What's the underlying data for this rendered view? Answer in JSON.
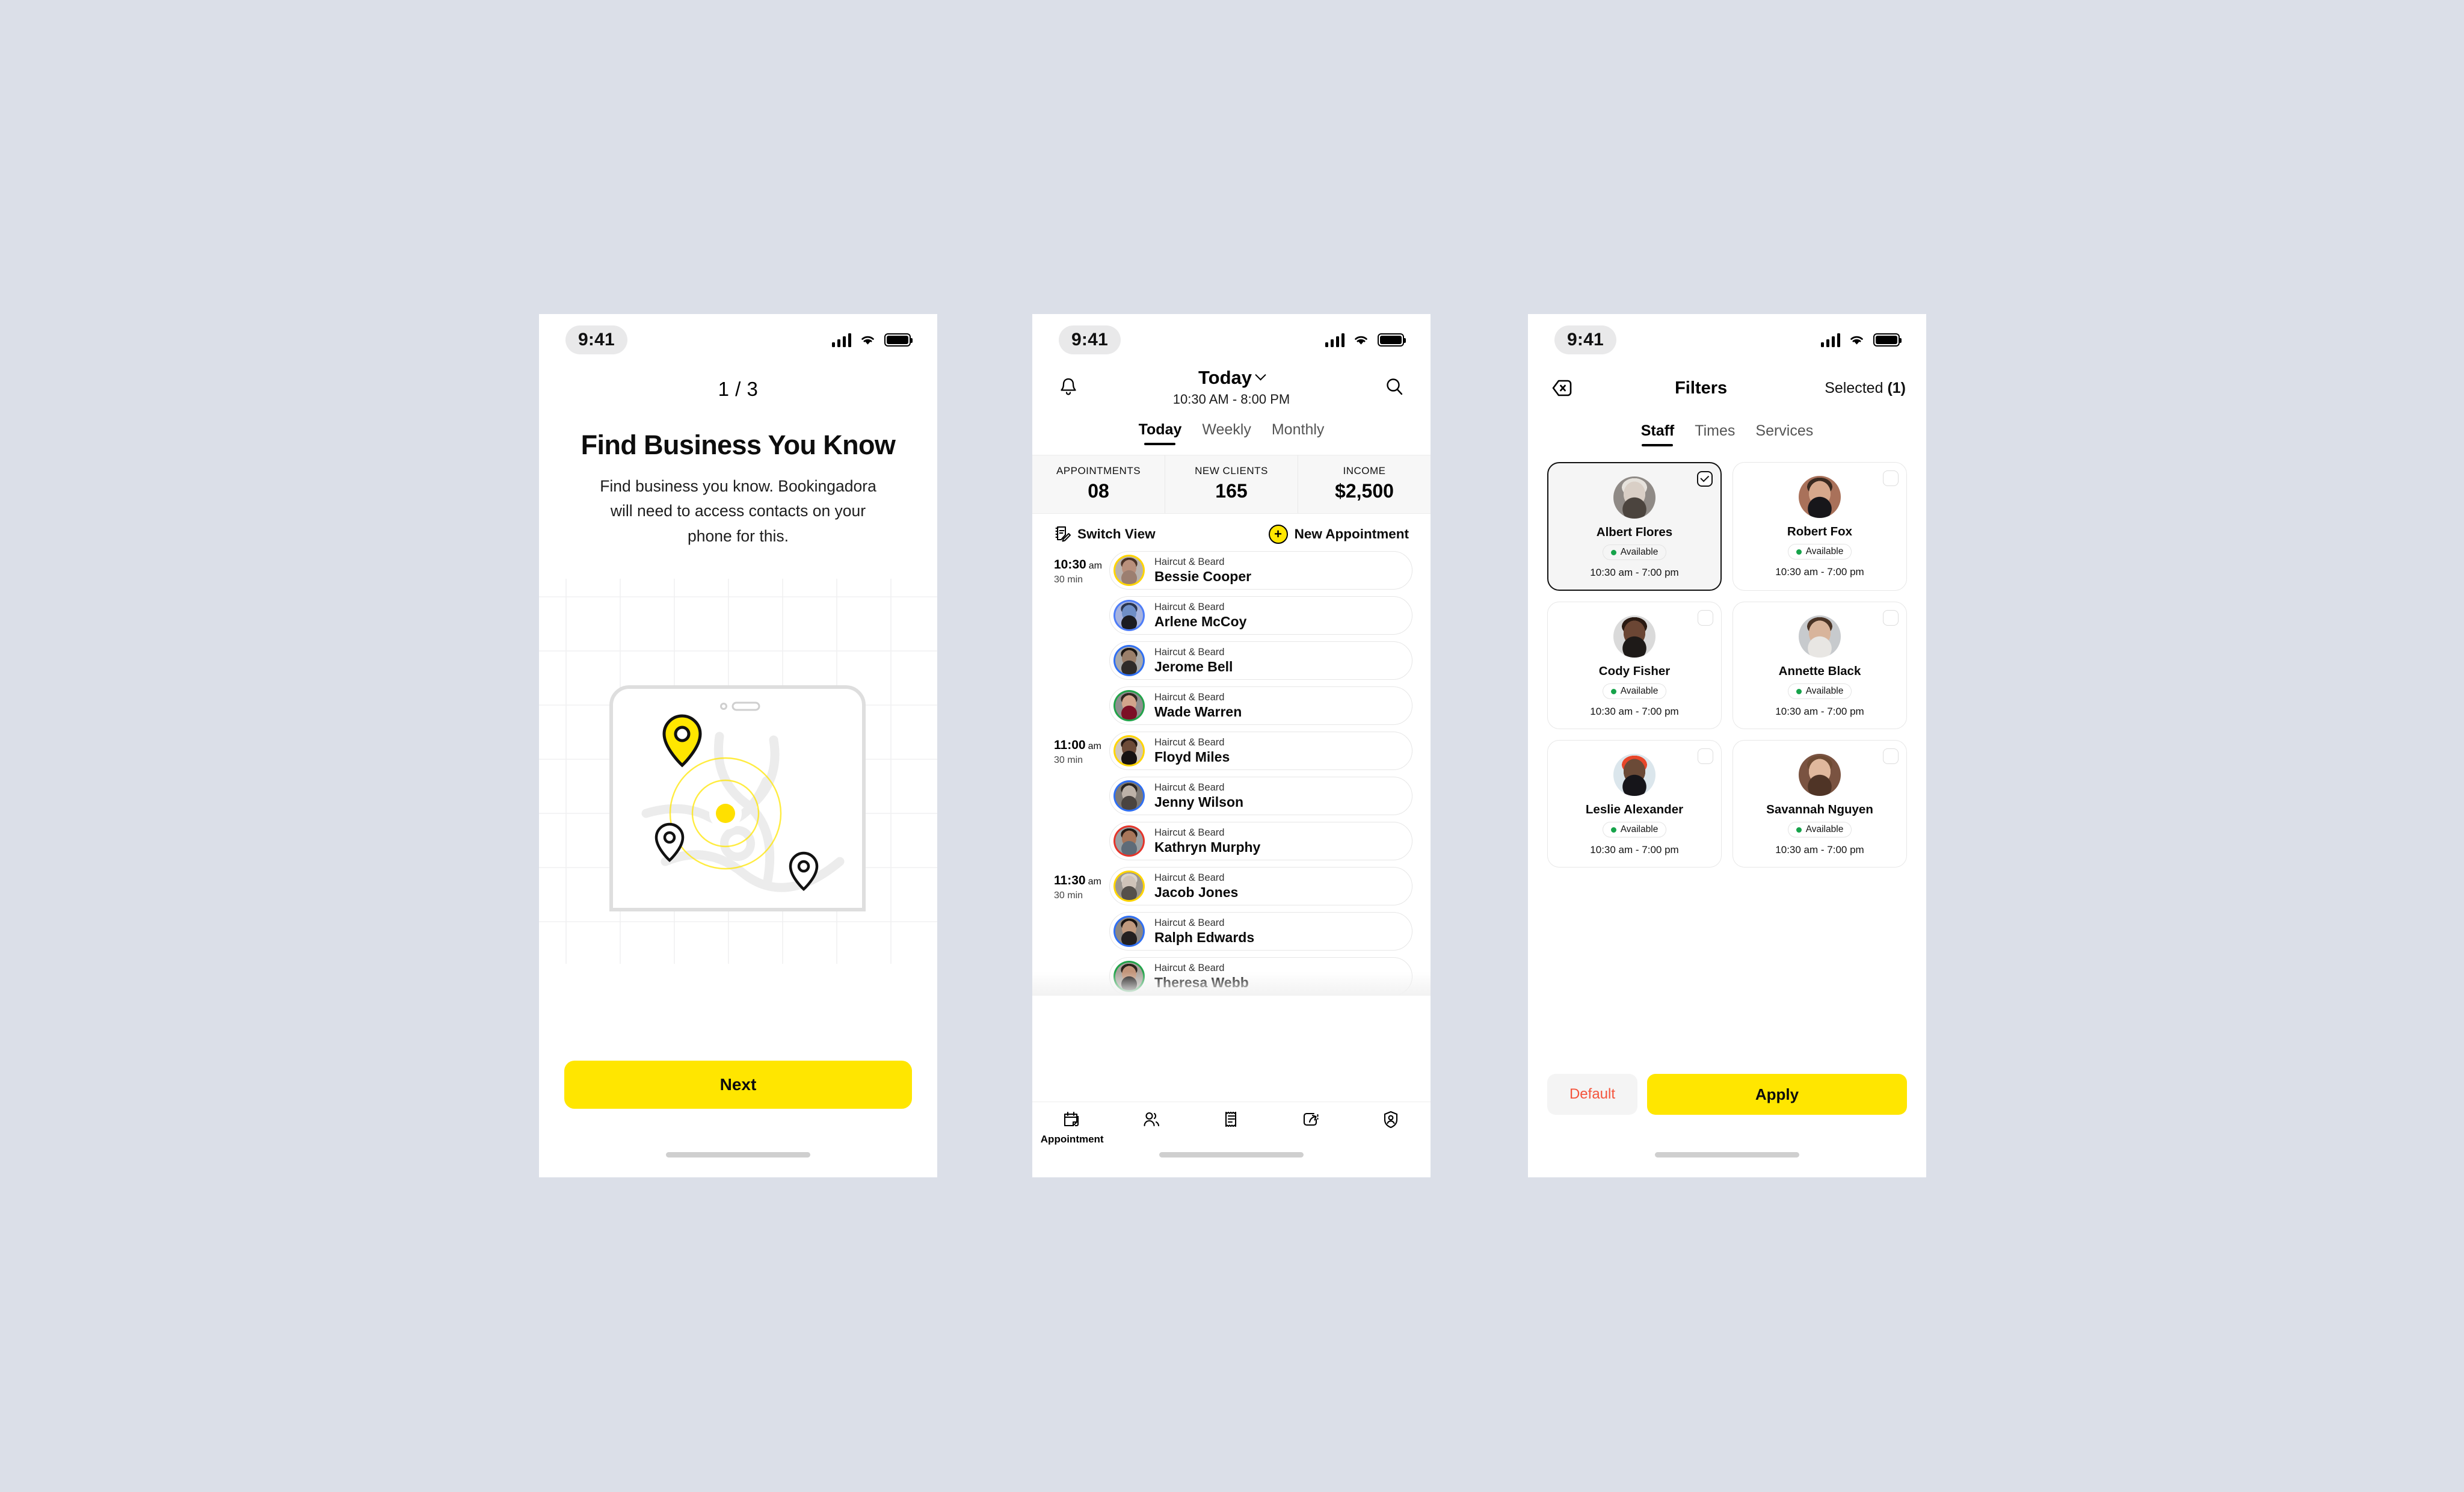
{
  "canvas": {
    "background": "#dbdfe8"
  },
  "theme": {
    "accent_yellow": "#ffe600",
    "text": "#0d0d0d",
    "green": "#16a34a",
    "red": "#f4543c"
  },
  "status_bar": {
    "time": "9:41",
    "signal_icon": "cellular-bars-icon",
    "wifi_icon": "wifi-icon",
    "battery_icon": "battery-icon"
  },
  "onboarding": {
    "pager": "1 / 3",
    "title": "Find Business You Know",
    "description": "Find business you know. Bookingadora will need to access contacts on your phone for this.",
    "next_label": "Next",
    "illustration": {
      "name": "map-location-illustration",
      "pin_active_icon": "map-pin-filled-icon",
      "pin_1_icon": "map-pin-outline-icon",
      "pin_2_icon": "map-pin-outline-icon",
      "pulse_icon": "location-pulse-icon"
    }
  },
  "appointments": {
    "bell_icon": "bell-icon",
    "search_icon": "search-icon",
    "title": "Today",
    "chevron_icon": "chevron-down-icon",
    "subtitle": "10:30 AM - 8:00 PM",
    "tabs": [
      {
        "label": "Today",
        "active": true
      },
      {
        "label": "Weekly",
        "active": false
      },
      {
        "label": "Monthly",
        "active": false
      }
    ],
    "stats": [
      {
        "label": "APPOINTMENTS",
        "value": "08"
      },
      {
        "label": "NEW CLIENTS",
        "value": "165"
      },
      {
        "label": "INCOME",
        "value": "$2,500"
      }
    ],
    "switch_view_label": "Switch View",
    "switch_view_icon": "switch-view-icon",
    "new_appointment_label": "New Appointment",
    "new_appointment_icon": "plus-circle-icon",
    "items": [
      {
        "time": "10:30",
        "ampm": "am",
        "duration": "30 min",
        "service": "Haircut & Beard",
        "name": "Bessie Cooper",
        "ring": "#ffd500",
        "skin": "#b9907c",
        "hair": "#4a3328",
        "shirt": "#9c7f70",
        "bg": "#b9b2ad"
      },
      {
        "time": "",
        "ampm": "",
        "duration": "",
        "service": "Haircut & Beard",
        "name": "Arlene McCoy",
        "ring": "#4d7cf7",
        "skin": "#6f8ec7",
        "hair": "#2a3550",
        "shirt": "#1b1b22",
        "bg": "#a7b3de"
      },
      {
        "time": "",
        "ampm": "",
        "duration": "",
        "service": "Haircut & Beard",
        "name": "Jerome Bell",
        "ring": "#2f6ff2",
        "skin": "#9b7f6a",
        "hair": "#1d1713",
        "shirt": "#2f2b29",
        "bg": "#a9a9a9"
      },
      {
        "time": "",
        "ampm": "",
        "duration": "",
        "service": "Haircut & Beard",
        "name": "Wade Warren",
        "ring": "#22a34a",
        "skin": "#d2a58c",
        "hair": "#2f2520",
        "shirt": "#7c1026",
        "bg": "#8e8e8e"
      },
      {
        "time": "11:00",
        "ampm": "am",
        "duration": "30 min",
        "service": "Haircut & Beard",
        "name": "Floyd Miles",
        "ring": "#ffd500",
        "skin": "#6d4b38",
        "hair": "#221712",
        "shirt": "#171312",
        "bg": "#cfc6bd"
      },
      {
        "time": "",
        "ampm": "",
        "duration": "",
        "service": "Haircut & Beard",
        "name": "Jenny Wilson",
        "ring": "#2f6ff2",
        "skin": "#bdb2a8",
        "hair": "#2a241f",
        "shirt": "#4a4440",
        "bg": "#7d7873"
      },
      {
        "time": "",
        "ampm": "",
        "duration": "",
        "service": "Haircut & Beard",
        "name": "Kathryn Murphy",
        "ring": "#e5342a",
        "skin": "#a8765a",
        "hair": "#241a14",
        "shirt": "#5e6b78",
        "bg": "#9aa0a3"
      },
      {
        "time": "11:30",
        "ampm": "am",
        "duration": "30 min",
        "service": "Haircut & Beard",
        "name": "Jacob Jones",
        "ring": "#ffd500",
        "skin": "#cfc3b8",
        "hair": "#d8d3cc",
        "shirt": "#55504b",
        "bg": "#9b9690"
      },
      {
        "time": "",
        "ampm": "",
        "duration": "",
        "service": "Haircut & Beard",
        "name": "Ralph Edwards",
        "ring": "#2f6ff2",
        "skin": "#c09a7e",
        "hair": "#1a1512",
        "shirt": "#232020",
        "bg": "#8b8681"
      },
      {
        "time": "",
        "ampm": "",
        "duration": "",
        "service": "Haircut & Beard",
        "name": "Theresa Webb",
        "ring": "#22a34a",
        "skin": "#c2957a",
        "hair": "#2b211b",
        "shirt": "#1d1a19",
        "bg": "#a8a29c"
      }
    ],
    "tabbar": [
      {
        "icon": "calendar-appointment-icon",
        "label": "Appointment",
        "active": true
      },
      {
        "icon": "clients-people-icon",
        "label": "",
        "active": false
      },
      {
        "icon": "receipt-invoice-icon",
        "label": "",
        "active": false
      },
      {
        "icon": "promo-share-icon",
        "label": "",
        "active": false
      },
      {
        "icon": "profile-shield-icon",
        "label": "",
        "active": false
      }
    ]
  },
  "filters": {
    "close_icon": "close-back-icon",
    "title": "Filters",
    "selected_label": "Selected",
    "selected_count": "(1)",
    "tabs": [
      {
        "label": "Staff",
        "active": true
      },
      {
        "label": "Times",
        "active": false
      },
      {
        "label": "Services",
        "active": false
      }
    ],
    "staff": [
      {
        "name": "Albert Flores",
        "status": "Available",
        "hours": "10:30 am - 7:00 pm",
        "selected": true,
        "skin": "#d9cfc6",
        "hair": "#e6e2dc",
        "shirt": "#4b443e",
        "bg": "#8f8a86"
      },
      {
        "name": "Robert Fox",
        "status": "Available",
        "hours": "10:30 am - 7:00 pm",
        "selected": false,
        "skin": "#d6a88c",
        "hair": "#3a2a20",
        "shirt": "#17161a",
        "bg": "#a9715a"
      },
      {
        "name": "Cody Fisher",
        "status": "Available",
        "hours": "10:30 am - 7:00 pm",
        "selected": false,
        "skin": "#6b4634",
        "hair": "#2a1a12",
        "shirt": "#1e1a18",
        "bg": "#dadada"
      },
      {
        "name": "Annette Black",
        "status": "Available",
        "hours": "10:30 am - 7:00 pm",
        "selected": false,
        "skin": "#d8b49b",
        "hair": "#4a3426",
        "shirt": "#e8e6e3",
        "bg": "#c7cacd"
      },
      {
        "name": "Leslie Alexander",
        "status": "Available",
        "hours": "10:30 am - 7:00 pm",
        "selected": false,
        "skin": "#6b4a37",
        "hair": "#e8462a",
        "shirt": "#16151a",
        "bg": "#dbe6ec"
      },
      {
        "name": "Savannah Nguyen",
        "status": "Available",
        "hours": "10:30 am - 7:00 pm",
        "selected": false,
        "skin": "#e0b89d",
        "hair": "#6e4b34",
        "shirt": "#4f3426",
        "bg": "#7a5341"
      }
    ],
    "default_label": "Default",
    "apply_label": "Apply"
  }
}
